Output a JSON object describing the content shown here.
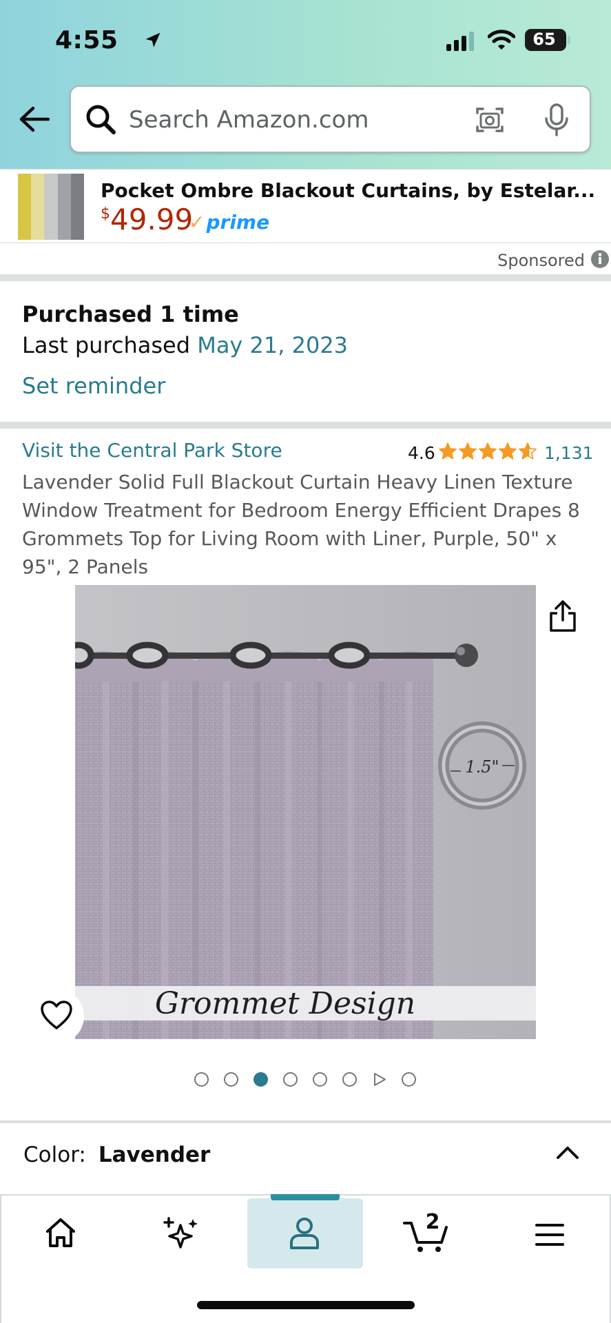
{
  "status_bar": {
    "time": "4:55",
    "battery": "65",
    "icons": [
      "location-arrow-icon",
      "cellular-signal-icon",
      "wifi-icon",
      "battery-icon"
    ]
  },
  "search": {
    "placeholder": "Search Amazon.com",
    "icons": [
      "back-arrow-icon",
      "search-icon",
      "camera-icon",
      "microphone-icon"
    ]
  },
  "sponsored_ad": {
    "title": "Pocket Ombre Blackout Curtains, by Estelar...",
    "price_currency": "$",
    "price_amount": "49.99",
    "prime_label": "prime",
    "sponsored_label": "Sponsored"
  },
  "purchase_history": {
    "purchased_count": "Purchased 1 time",
    "last_purchased_label": "Last purchased",
    "last_purchased_date": "May 21, 2023",
    "set_reminder_label": "Set reminder"
  },
  "product": {
    "store_link": "Visit the Central Park Store",
    "rating": "4.6",
    "rating_stars_value": 4.6,
    "rating_count": "1,131",
    "title": "Lavender Solid Full Blackout Curtain Heavy Linen Texture Window Treatment for Bedroom Energy Efficient Drapes 8 Grommets Top for Living Room with Liner, Purple, 50\" x 95\", 2 Panels",
    "image_caption": "Grommet Design",
    "image_ring_label": "1.5\"",
    "image_count": 8,
    "active_image_index": 2,
    "video_thumb_index": 6
  },
  "color_selector": {
    "label": "Color:",
    "value": "Lavender"
  },
  "bottom_nav": {
    "items": [
      "home-icon",
      "ai-sparkle-icon",
      "account-icon",
      "cart-icon",
      "menu-icon"
    ],
    "active": "account-icon",
    "cart_count": "2"
  },
  "colors": {
    "link_teal": "#2a7b8f",
    "price_red": "#b12704",
    "star_orange": "#f59a23",
    "prime_blue": "#1a98ff",
    "header_gradient_start": "#8fd3dd",
    "header_gradient_end": "#b8ead6"
  }
}
